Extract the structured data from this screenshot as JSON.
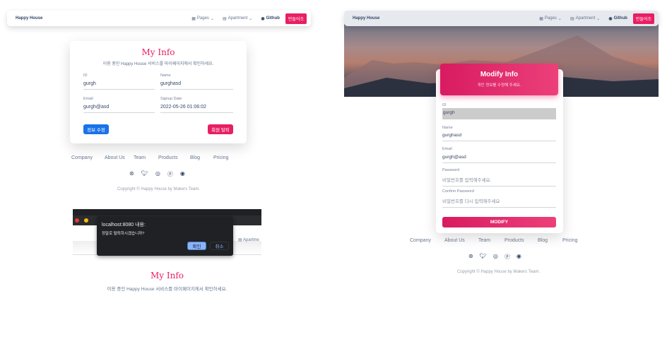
{
  "nav": {
    "brand": "Happy House",
    "pages": "Pages",
    "apartment": "Apartment",
    "github": "Github",
    "make": "만들어조"
  },
  "myinfo": {
    "title": "My Info",
    "subtitle": "이용 중인 Happy House 서비스를 마이페이지에서 확인하세요.",
    "fields": [
      {
        "label": "ID",
        "value": "gurgh"
      },
      {
        "label": "Name",
        "value": "gurghasd"
      },
      {
        "label": "Email",
        "value": "gurgh@asd"
      },
      {
        "label": "Signup Date",
        "value": "2022-05-26 01:06:02"
      }
    ],
    "edit": "정보 수정",
    "withdraw": "회원 탈퇴"
  },
  "footer": {
    "links": [
      "Company",
      "About Us",
      "Team",
      "Products",
      "Blog",
      "Pricing"
    ],
    "icons": [
      "dribbble-icon",
      "twitter-icon",
      "instagram-icon",
      "pinterest-icon",
      "github-icon"
    ],
    "copyright": "Copyright © Happy House by Makers Team."
  },
  "dialog": {
    "title": "localhost:8080 내용:",
    "message": "정말로 탈퇴하시겠습니까?",
    "ok": "확인",
    "cancel": "취소",
    "bg_apartment": "Apartme"
  },
  "modify": {
    "title": "Modify Info",
    "subtitle": "개인 정보를 수정해 주세요.",
    "id_label": "ID",
    "id_value": "gurgh",
    "name_label": "Name",
    "name_value": "gurghasd",
    "email_label": "Email",
    "email_value": "gurgh@asd",
    "pw_label": "Password",
    "pw_placeholder": "비밀번호를 입력해주세요.",
    "pw2_label": "Confirm Password",
    "pw2_placeholder": "비밀번호를 다시 입력해주세요",
    "button": "MODIFY"
  },
  "colors": {
    "primary": "#e91e63",
    "info": "#1a73e8"
  }
}
